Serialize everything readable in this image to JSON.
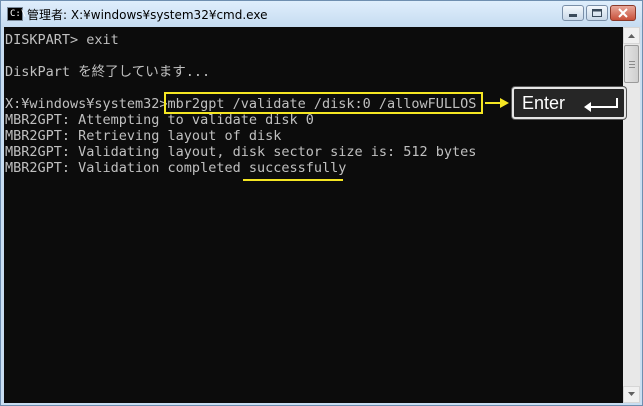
{
  "window": {
    "title": "管理者: X:¥windows¥system32¥cmd.exe",
    "icon": "console-icon",
    "controls": [
      "minimize-icon",
      "maximize-icon",
      "close-icon"
    ]
  },
  "console": {
    "lines": [
      "DISKPART> exit",
      "",
      "DiskPart を終了しています...",
      "",
      "X:¥windows¥system32>mbr2gpt /validate /disk:0 /allowFULLOS",
      "MBR2GPT: Attempting to validate disk 0",
      "MBR2GPT: Retrieving layout of disk",
      "MBR2GPT: Validating layout, disk sector size is: 512 bytes",
      "MBR2GPT: Validation completed successfully"
    ],
    "text_color": "#c0c0c0",
    "background": "#0c0c0c"
  },
  "annotations": {
    "enter_key_label": "Enter",
    "enter_key_icon": "enter-return-icon",
    "highlight_color": "#f5e623"
  }
}
